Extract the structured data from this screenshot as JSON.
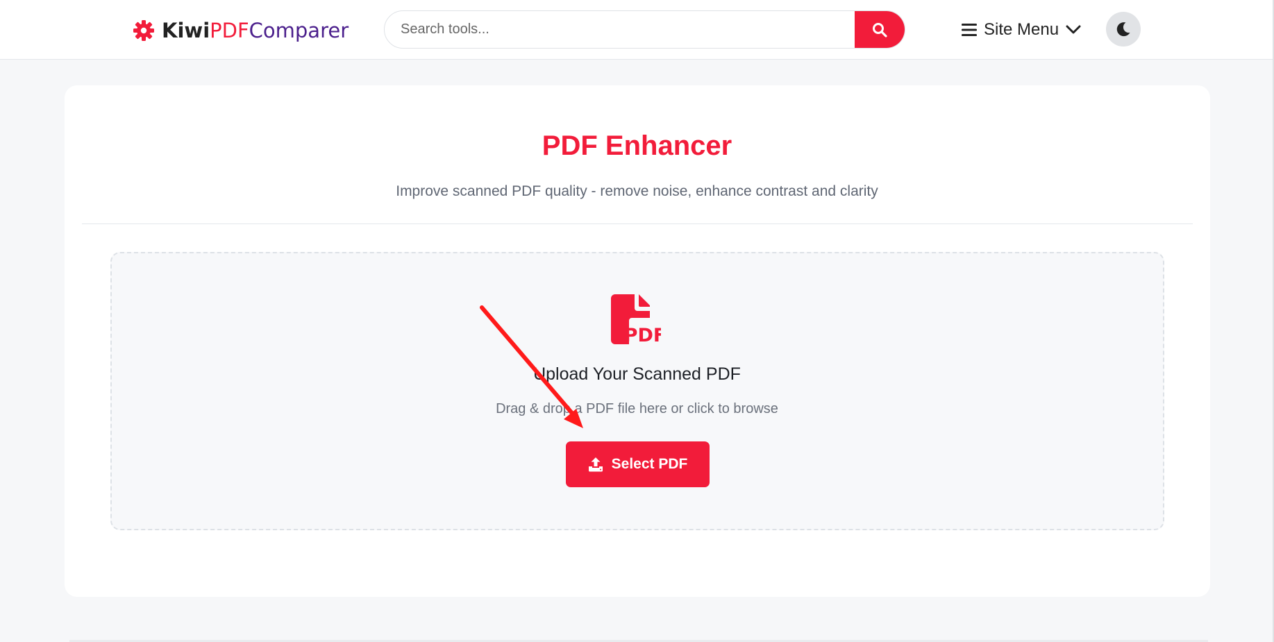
{
  "header": {
    "logo": {
      "part1": "Kiwi",
      "part2": "PDF",
      "part3": "Comparer"
    },
    "search": {
      "placeholder": "Search tools..."
    },
    "site_menu_label": "Site Menu"
  },
  "main": {
    "title": "PDF Enhancer",
    "subtitle": "Improve scanned PDF quality - remove noise, enhance contrast and clarity",
    "upload": {
      "icon_text": "PDF",
      "title": "Upload Your Scanned PDF",
      "subtitle": "Drag & drop a PDF file here or click to browse",
      "button_label": "Select PDF"
    }
  },
  "colors": {
    "accent": "#f21c3a",
    "logo_purple": "#4b1f8c"
  },
  "icons": [
    "gear-icon",
    "search-icon",
    "hamburger-icon",
    "chevron-down-icon",
    "moon-icon",
    "pdf-file-icon",
    "upload-icon",
    "annotation-arrow"
  ]
}
